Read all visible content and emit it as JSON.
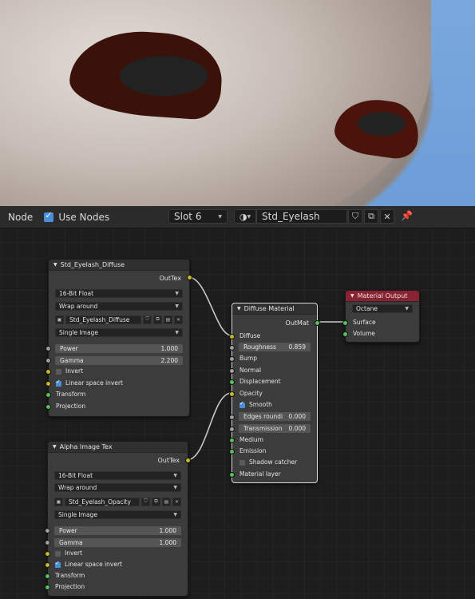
{
  "header": {
    "editor_label": "Node",
    "use_nodes_label": "Use Nodes",
    "slot_label": "Slot 6",
    "material_name": "Std_Eyelash"
  },
  "nodes": {
    "eyelash_diffuse": {
      "title": "Std_Eyelash_Diffuse",
      "output_label": "OutTex",
      "bit_depth": "16-Bit Float",
      "wrap": "Wrap around",
      "image_name": "Std_Eyelash_Diffuse",
      "source": "Single Image",
      "power_label": "Power",
      "power_value": "1.000",
      "gamma_label": "Gamma",
      "gamma_value": "2.200",
      "invert_label": "Invert",
      "linear_label": "Linear space invert",
      "transform_label": "Transform",
      "projection_label": "Projection"
    },
    "alpha_image": {
      "title": "Alpha Image Tex",
      "output_label": "OutTex",
      "bit_depth": "16-Bit Float",
      "wrap": "Wrap around",
      "image_name": "Std_Eyelash_Opacity",
      "source": "Single Image",
      "power_label": "Power",
      "power_value": "1.000",
      "gamma_label": "Gamma",
      "gamma_value": "1.000",
      "invert_label": "Invert",
      "linear_label": "Linear space invert",
      "transform_label": "Transform",
      "projection_label": "Projection"
    },
    "diffuse_material": {
      "title": "Diffuse Material",
      "output_label": "OutMat",
      "diffuse_label": "Diffuse",
      "roughness_label": "Roughness",
      "roughness_value": "0.859",
      "bump_label": "Bump",
      "normal_label": "Normal",
      "displacement_label": "Displacement",
      "opacity_label": "Opacity",
      "smooth_label": "Smooth",
      "edges_label": "Edges roundi",
      "edges_value": "0.000",
      "transmission_label": "Transmission",
      "transmission_value": "0.000",
      "medium_label": "Medium",
      "emission_label": "Emission",
      "shadow_label": "Shadow catcher",
      "layer_label": "Material layer"
    },
    "material_output": {
      "title": "Material Output",
      "renderer": "Octane",
      "surface_label": "Surface",
      "volume_label": "Volume"
    }
  },
  "colors": {
    "output_header": "#8a2231",
    "socket_texture": "#c7b82a",
    "socket_material": "#58c05a",
    "socket_value": "#9e9e9e",
    "checkbox": "#4a90d9"
  }
}
